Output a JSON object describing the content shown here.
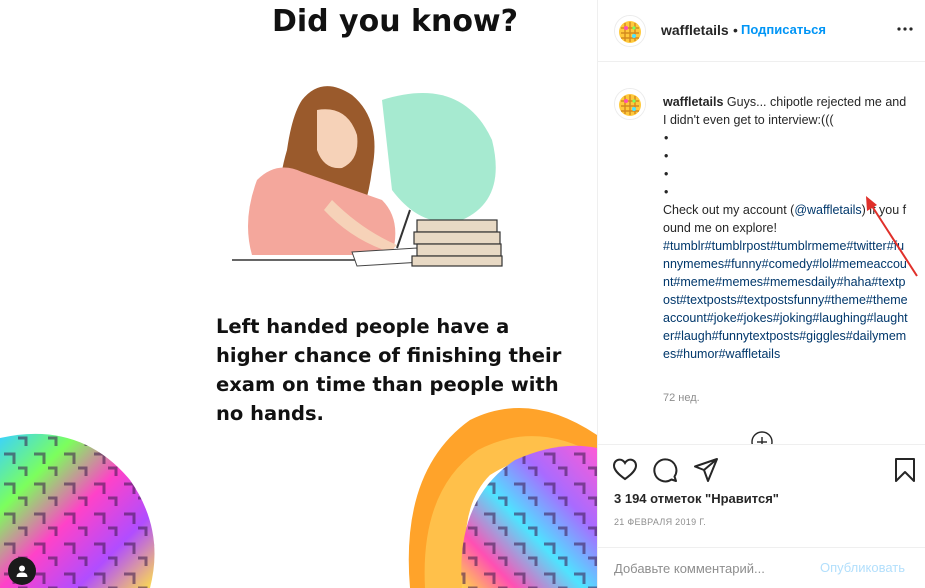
{
  "post": {
    "username": "waffletails",
    "follow_label": "Подписаться",
    "header_separator": "•",
    "caption_text_1": "Guys... chipotle rejected me and I didn't even get to interview:(((",
    "dots": [
      "•",
      "•",
      "•",
      "•"
    ],
    "caption_text_2_before": "Check out my account (",
    "mention": "@waffletails",
    "caption_text_2_after": ") if you found me on explore!",
    "hashtags": "#tumblr#tumblrpost#tumblrmeme#twitter#funnymemes#funny#comedy#lol#memeaccount#meme#memes#memesdaily#haha#textpost#textposts#textpostsfunny#theme#themeaccount#joke#jokes#joking#laughing#laughter#laugh#funnytextposts#giggles#dailymemes#humor#waffletails",
    "time_ago": "72 нед.",
    "likes": "3 194 отметок \"Нравится\"",
    "date": "21 ФЕВРАЛЯ 2019 Г.",
    "comment_placeholder": "Добавьте комментарий...",
    "publish_label": "Опубликовать"
  },
  "meme": {
    "title": "Did you know?",
    "caption": "Left handed people have a higher chance of finishing their exam on time than people with no hands."
  },
  "icons": {
    "more": "more-horizontal-icon",
    "like": "heart-icon",
    "comment": "comment-bubble-icon",
    "share": "paper-plane-icon",
    "save": "bookmark-icon",
    "load_more": "plus-circle-icon",
    "user": "user-icon"
  },
  "colors": {
    "follow_blue": "#0095f6",
    "link_blue": "#00376b",
    "annotation_red": "#e0302a",
    "publish_disabled": "#b2dffc"
  }
}
